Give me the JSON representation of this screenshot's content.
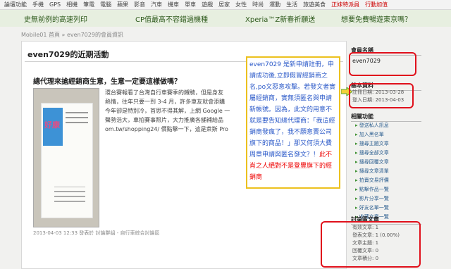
{
  "topnav": {
    "items": [
      "論壇功能",
      "手機",
      "GPS",
      "相機",
      "筆電",
      "電腦",
      "蘋果",
      "影音",
      "汽車",
      "機車",
      "單車",
      "遊戲",
      "居家",
      "女性",
      "時尚",
      "運動",
      "生活",
      "旅遊美食"
    ],
    "hot": "正妹特派員",
    "event": "行動加值"
  },
  "promo": [
    "史無前例的高速列印",
    "CP值最高不容錯過機種",
    "Xperia™Z新春祈願送",
    "想要免費暢遊東京嗎？"
  ],
  "breadcrumb": "Mobile01 首頁 » even7029的會員資訊",
  "main": {
    "title": "even7029的近期活動",
    "post_title": "總代理來搶經銷商生意，生意一定要這樣做嗎？",
    "excerpt_lines": [
      "環台賽報看了台灣自行車賽季的鐵騎，但是身友",
      "熱情，往年只要一到 3-4 月，許多車友就會添購",
      "今年卻是特別冷，首思不得其解，上網 Google 一",
      "聲勢浩大，車拍賽事照片，大力推廣各舖補給品",
      "om.tw/shopping24/ 價點擊一下，這是萊斯 Pro"
    ],
    "post_meta": "2013-04-03 12:33 發表於 討論群組 - 自行車綜合討論區",
    "card_logo": "好康"
  },
  "annotation": {
    "blue_text": "even7029 是新申請註冊，申請成功後,立即假冒經銷商之名,po文惡意攻擊。若發文者實屬經銷商，實無須匿名與申請新帳號。因為，此文的用意不就是要告知總代理商：「我這經銷商發瘋了，我不願意賣公司旗下的商品！」那又何須大費周章申請與匿名發文？！",
    "red_text": "此不肖之人絕對不是登豐旗下的經銷商"
  },
  "sidebar": {
    "member_heading": "會員名稱",
    "member_name": "even7029",
    "basic_heading": "基本資料",
    "register_date": "註冊日期: 2013-03-28",
    "login_date": "登入日期: 2013-04-03",
    "functions_heading": "相關功能",
    "functions": [
      "發送私人訊息",
      "加入黑名單",
      "搜尋主題文章",
      "搜尋全部文章",
      "搜尋回覆文章",
      "搜尋文章清單",
      "拍賣交易評價",
      "點擊作品一覽",
      "影片分享一覽",
      "好友名單一覽",
      "收藏文章一覽"
    ],
    "stats_heading": "討論區文章",
    "stats": [
      "有效文章: 1",
      "發表文章: 1 (0.00%)",
      "文章主題: 1",
      "回覆文章: 0",
      "文章積分: 0"
    ]
  },
  "colors": {
    "annotation_blue": "#2a58c8",
    "annotation_red": "#e00000",
    "annotation_border": "#ecc11f",
    "highlight_box": "#e0101b",
    "promo_bg": "#e7efe0"
  }
}
